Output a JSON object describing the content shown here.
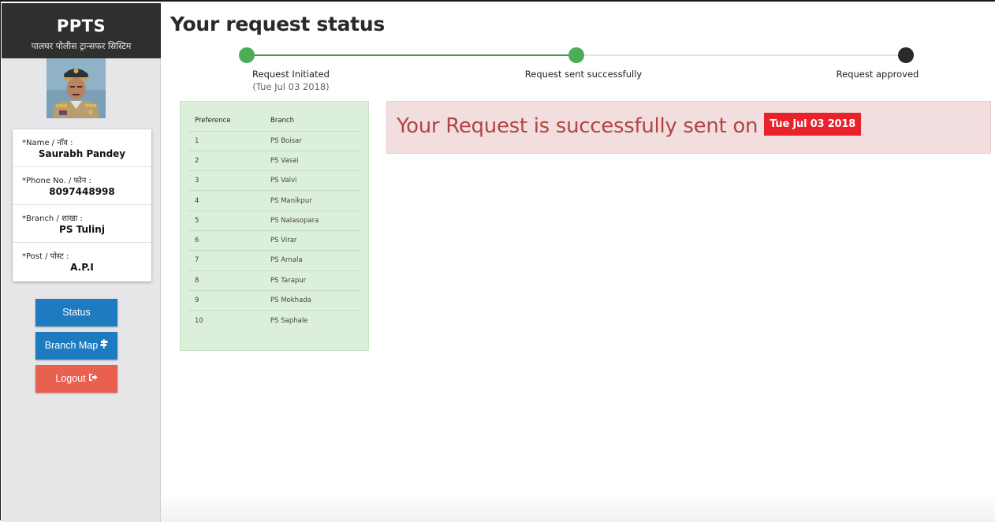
{
  "brand": {
    "title": "PPTS",
    "subtitle": "पालघर पोलीस ट्रान्सफर सिस्टिम"
  },
  "profile": {
    "fields": [
      {
        "label": "*Name / नाॅव :",
        "value": "Saurabh Pandey"
      },
      {
        "label": "*Phone No. / फोन :",
        "value": "8097448998"
      },
      {
        "label": "*Branch / शाखा :",
        "value": "PS Tulinj"
      },
      {
        "label": "*Post / पोस्ट :",
        "value": "A.P.I"
      }
    ]
  },
  "nav": {
    "status_label": "Status",
    "branch_map_label": "Branch Map",
    "logout_label": "Logout"
  },
  "page": {
    "title": "Your request status"
  },
  "progress": {
    "steps": [
      {
        "label": "Request Initiated",
        "date": "(Tue Jul 03 2018)",
        "state": "done"
      },
      {
        "label": "Request sent successfully",
        "date": "",
        "state": "done"
      },
      {
        "label": "Request approved",
        "date": "",
        "state": "pending"
      }
    ],
    "colors": {
      "done": "#4cac57",
      "pending": "#2a2a2a",
      "line_done": "#4a9b4c",
      "line_todo": "#e4e4e4"
    }
  },
  "preferences": {
    "headers": [
      "Preference",
      "Branch"
    ],
    "rows": [
      [
        "1",
        "PS Boisar"
      ],
      [
        "2",
        "PS Vasai"
      ],
      [
        "3",
        "PS Valvi"
      ],
      [
        "4",
        "PS Manikpur"
      ],
      [
        "5",
        "PS Nalasopara"
      ],
      [
        "6",
        "PS Virar"
      ],
      [
        "7",
        "PS Arnala"
      ],
      [
        "8",
        "PS Tarapur"
      ],
      [
        "9",
        "PS Mokhada"
      ],
      [
        "10",
        "PS Saphale"
      ]
    ]
  },
  "alert": {
    "text": "Your Request is successfully sent on",
    "date_badge": "Tue Jul 03 2018"
  },
  "colors": {
    "brand_bg": "#2f2f2f",
    "primary_button": "#1f7bbf",
    "danger_button": "#e9604f",
    "alert_bg": "#f2dede",
    "alert_text": "#b04643",
    "badge_bg": "#e8212a",
    "panel_bg": "#dcefdb"
  },
  "icons": {
    "branch_map": "map-signs-icon",
    "logout": "sign-out-icon"
  }
}
